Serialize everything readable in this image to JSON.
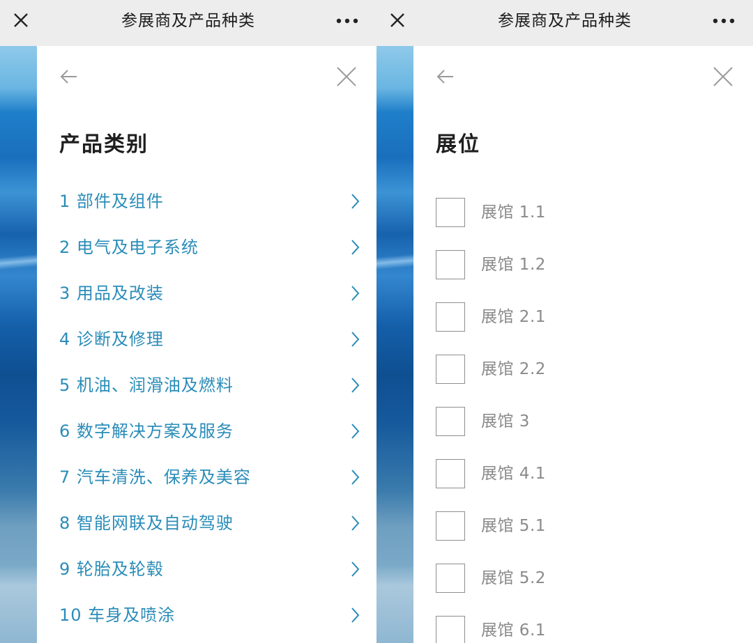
{
  "left": {
    "topbar": {
      "title": "参展商及产品种类"
    },
    "panel": {
      "heading": "产品类别",
      "categories": [
        {
          "label": "1 部件及组件"
        },
        {
          "label": "2 电气及电子系统"
        },
        {
          "label": "3 用品及改装"
        },
        {
          "label": "4 诊断及修理"
        },
        {
          "label": "5 机油、润滑油及燃料"
        },
        {
          "label": "6 数字解决方案及服务"
        },
        {
          "label": "7 汽车清洗、保养及美容"
        },
        {
          "label": "8 智能网联及自动驾驶"
        },
        {
          "label": "9 轮胎及轮毂"
        },
        {
          "label": "10 车身及喷涂"
        }
      ]
    }
  },
  "right": {
    "topbar": {
      "title": "参展商及产品种类"
    },
    "panel": {
      "heading": "展位",
      "halls": [
        {
          "label": "展馆 1.1",
          "checked": false
        },
        {
          "label": "展馆 1.2",
          "checked": false
        },
        {
          "label": "展馆 2.1",
          "checked": false
        },
        {
          "label": "展馆 2.2",
          "checked": false
        },
        {
          "label": "展馆 3",
          "checked": false
        },
        {
          "label": "展馆 4.1",
          "checked": false
        },
        {
          "label": "展馆 5.1",
          "checked": false
        },
        {
          "label": "展馆 5.2",
          "checked": false
        },
        {
          "label": "展馆 6.1",
          "checked": false
        }
      ]
    }
  },
  "colors": {
    "link": "#2a8cb8",
    "topbar_bg": "#ededed",
    "muted_text": "#8a8a8a"
  },
  "icons": {
    "close": "close-icon",
    "more": "more-icon",
    "back": "back-arrow-icon",
    "chevron": "chevron-right-icon"
  }
}
